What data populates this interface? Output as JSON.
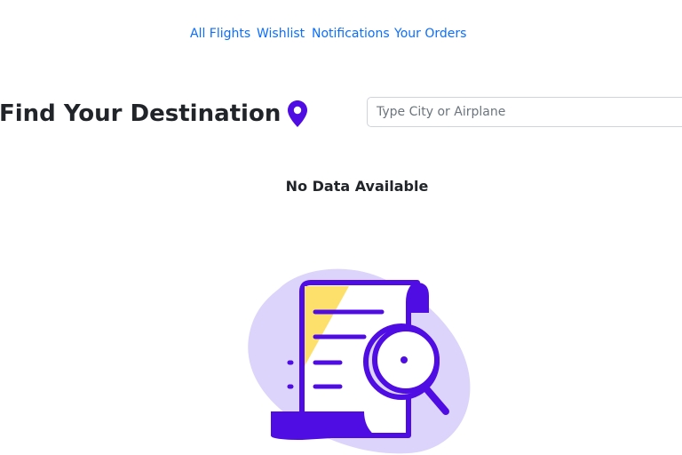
{
  "nav": {
    "all_flights": "All Flights",
    "wishlist": "Wishlist",
    "notifications": "Notifications",
    "your_orders": "Your Orders"
  },
  "header": {
    "title": "Find Your Destination",
    "pin_icon": "map-pin-icon"
  },
  "search": {
    "placeholder": "Type City or Airplane",
    "value": ""
  },
  "empty_state": {
    "message": "No Data Available",
    "illustration": "document-search-illustration"
  },
  "colors": {
    "link": "#0d6efd",
    "accent_purple": "#4f0ce3",
    "blob_lavender": "#dcd4fb",
    "paper_yellow": "#fde06b",
    "text_dark": "#212529"
  }
}
